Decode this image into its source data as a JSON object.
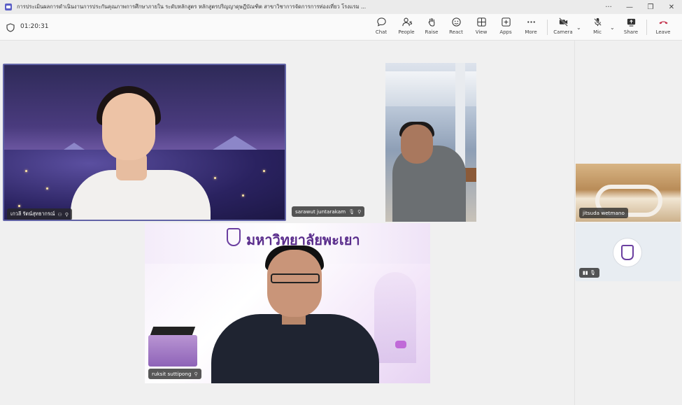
{
  "window": {
    "title": "การประเมินผลการดำเนินงานการประกันคุณภาพการศึกษาภายใน ระดับหลักสูตร หลักสูตรปริญญาดุษฎีบัณฑิต สาขาวิชาการจัดการการท่องเที่ยว โรงแรม ...",
    "controls": [
      "···",
      "—",
      "❐",
      "✕"
    ]
  },
  "toolbar": {
    "timer": "01:20:31",
    "people_count": "5",
    "buttons": {
      "chat": "Chat",
      "people": "People",
      "raise": "Raise",
      "react": "React",
      "view": "View",
      "apps": "Apps",
      "more": "More",
      "camera": "Camera",
      "mic": "Mic",
      "share": "Share",
      "leave": "Leave"
    },
    "leave_color": "#c4314b"
  },
  "participants": {
    "tile1": "เกวลี รัตน์สุทธากรณ์",
    "tile2": "sarawut juntarakam",
    "tile4": "ruksit suttipong",
    "side1": "jitsuda wetmano"
  },
  "banner": {
    "university": "มหาวิทยาลัยพะเยา"
  },
  "accent": "#6264a7"
}
